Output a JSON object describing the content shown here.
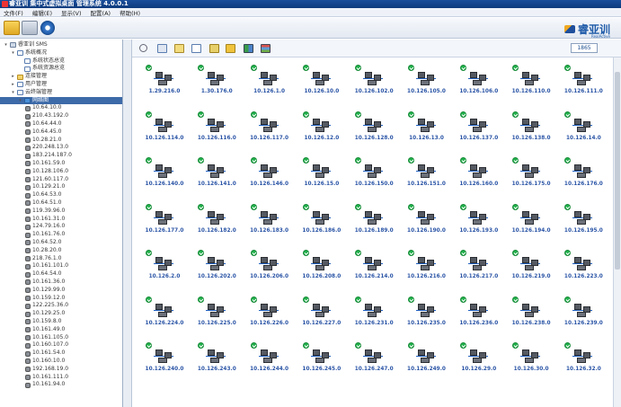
{
  "app": {
    "title": "睿亚训 集中式虚拟桌面 管理系统 4.0.0.1"
  },
  "menu": [
    "文件(F)",
    "编辑(E)",
    "显示(V)",
    "配置(A)",
    "帮助(H)"
  ],
  "logo": {
    "text": "睿亚训",
    "sub": "RealActive"
  },
  "counter": "1865",
  "tree": [
    {
      "label": "睿亚训 SMS",
      "level": 0,
      "twisty": "▾",
      "icon": "root"
    },
    {
      "label": "系统概况",
      "level": 1,
      "twisty": "▾",
      "icon": "doc"
    },
    {
      "label": "系统状态总览",
      "level": 2,
      "twisty": "",
      "icon": "doc"
    },
    {
      "label": "系统资源总览",
      "level": 2,
      "twisty": "",
      "icon": "doc"
    },
    {
      "label": "连接管理",
      "level": 1,
      "twisty": "▸",
      "icon": "folder"
    },
    {
      "label": "用户管理",
      "level": 1,
      "twisty": "▸",
      "icon": "doc"
    },
    {
      "label": "云终端管理",
      "level": 1,
      "twisty": "▾",
      "icon": "doc"
    },
    {
      "label": "网络图",
      "level": 2,
      "twisty": "▾",
      "icon": "net",
      "selected": true
    },
    {
      "label": "10.64.10.0",
      "level": 3,
      "icon": "node"
    },
    {
      "label": "210.43.192.0",
      "level": 3,
      "icon": "node"
    },
    {
      "label": "10.64.44.0",
      "level": 3,
      "icon": "node"
    },
    {
      "label": "10.64.45.0",
      "level": 3,
      "icon": "node"
    },
    {
      "label": "10.28.21.0",
      "level": 3,
      "icon": "node"
    },
    {
      "label": "220.248.13.0",
      "level": 3,
      "icon": "node"
    },
    {
      "label": "183.214.187.0",
      "level": 3,
      "icon": "node"
    },
    {
      "label": "10.161.59.0",
      "level": 3,
      "icon": "node"
    },
    {
      "label": "10.128.106.0",
      "level": 3,
      "icon": "node"
    },
    {
      "label": "121.60.117.0",
      "level": 3,
      "icon": "node"
    },
    {
      "label": "10.129.21.0",
      "level": 3,
      "icon": "node"
    },
    {
      "label": "10.64.53.0",
      "level": 3,
      "icon": "node"
    },
    {
      "label": "10.64.51.0",
      "level": 3,
      "icon": "node"
    },
    {
      "label": "119.39.96.0",
      "level": 3,
      "icon": "node"
    },
    {
      "label": "10.161.31.0",
      "level": 3,
      "icon": "node"
    },
    {
      "label": "124.79.16.0",
      "level": 3,
      "icon": "node"
    },
    {
      "label": "10.161.76.0",
      "level": 3,
      "icon": "node"
    },
    {
      "label": "10.64.52.0",
      "level": 3,
      "icon": "node"
    },
    {
      "label": "10.28.20.0",
      "level": 3,
      "icon": "node"
    },
    {
      "label": "218.76.1.0",
      "level": 3,
      "icon": "node"
    },
    {
      "label": "10.161.101.0",
      "level": 3,
      "icon": "node"
    },
    {
      "label": "10.64.54.0",
      "level": 3,
      "icon": "node"
    },
    {
      "label": "10.161.36.0",
      "level": 3,
      "icon": "node"
    },
    {
      "label": "10.129.99.0",
      "level": 3,
      "icon": "node"
    },
    {
      "label": "10.159.12.0",
      "level": 3,
      "icon": "node"
    },
    {
      "label": "122.225.36.0",
      "level": 3,
      "icon": "node"
    },
    {
      "label": "10.129.25.0",
      "level": 3,
      "icon": "node"
    },
    {
      "label": "10.159.8.0",
      "level": 3,
      "icon": "node"
    },
    {
      "label": "10.161.49.0",
      "level": 3,
      "icon": "node"
    },
    {
      "label": "10.161.105.0",
      "level": 3,
      "icon": "node"
    },
    {
      "label": "10.160.107.0",
      "level": 3,
      "icon": "node"
    },
    {
      "label": "10.161.54.0",
      "level": 3,
      "icon": "node"
    },
    {
      "label": "10.160.10.0",
      "level": 3,
      "icon": "node"
    },
    {
      "label": "192.168.19.0",
      "level": 3,
      "icon": "node"
    },
    {
      "label": "10.161.111.0",
      "level": 3,
      "icon": "node"
    },
    {
      "label": "10.161.94.0",
      "level": 3,
      "icon": "node"
    }
  ],
  "nodes": [
    "1.29.216.0",
    "1.30.176.0",
    "10.126.1.0",
    "10.126.10.0",
    "10.126.102.0",
    "10.126.105.0",
    "10.126.106.0",
    "10.126.110.0",
    "10.126.111.0",
    "10.126.114.0",
    "10.126.116.0",
    "10.126.117.0",
    "10.126.12.0",
    "10.126.128.0",
    "10.126.13.0",
    "10.126.137.0",
    "10.126.138.0",
    "10.126.14.0",
    "10.126.140.0",
    "10.126.141.0",
    "10.126.146.0",
    "10.126.15.0",
    "10.126.150.0",
    "10.126.151.0",
    "10.126.160.0",
    "10.126.175.0",
    "10.126.176.0",
    "10.126.177.0",
    "10.126.182.0",
    "10.126.183.0",
    "10.126.186.0",
    "10.126.189.0",
    "10.126.190.0",
    "10.126.193.0",
    "10.126.194.0",
    "10.126.195.0",
    "10.126.2.0",
    "10.126.202.0",
    "10.126.206.0",
    "10.126.208.0",
    "10.126.214.0",
    "10.126.216.0",
    "10.126.217.0",
    "10.126.219.0",
    "10.126.223.0",
    "10.126.224.0",
    "10.126.225.0",
    "10.126.226.0",
    "10.126.227.0",
    "10.126.231.0",
    "10.126.235.0",
    "10.126.236.0",
    "10.126.238.0",
    "10.126.239.0",
    "10.126.240.0",
    "10.126.243.0",
    "10.126.244.0",
    "10.126.245.0",
    "10.126.247.0",
    "10.126.249.0",
    "10.126.29.0",
    "10.126.30.0",
    "10.126.32.0"
  ],
  "colors": {
    "status_ok": "#22b14c",
    "ip_text": "#2b55a6",
    "selection": "#3d6aa8"
  }
}
